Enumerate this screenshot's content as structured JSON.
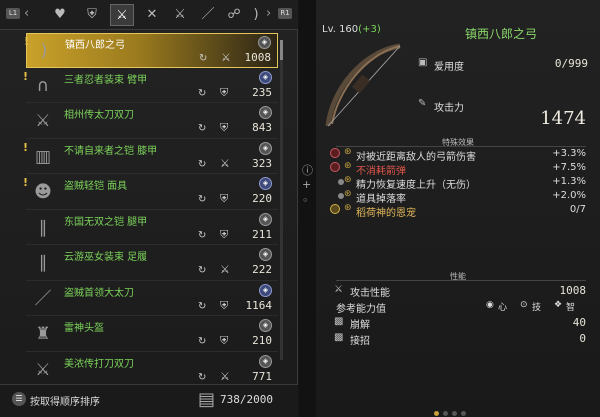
{
  "tabs": {
    "left_badge": "L1",
    "right_badge": "R1",
    "icons": [
      "heart-icon",
      "armor-icon",
      "crossed-swords-icon",
      "crossed-blades-icon",
      "dual-swords-icon",
      "spear-icon",
      "scythe-icon",
      "axe-icon",
      "bow-icon"
    ]
  },
  "inventory": {
    "items": [
      {
        "name": "镇西八郎之弓",
        "value": "1008",
        "new": true,
        "selected": true
      },
      {
        "name": "三者忍者装束 臂甲",
        "value": "235",
        "new": true,
        "selected": false
      },
      {
        "name": "相州传太刀双刀",
        "value": "843",
        "new": false,
        "selected": false
      },
      {
        "name": "不请自来者之铠 膝甲",
        "value": "323",
        "new": true,
        "selected": false
      },
      {
        "name": "盗贼轻铠 面具",
        "value": "220",
        "new": true,
        "selected": false
      },
      {
        "name": "东国无双之铠 腿甲",
        "value": "211",
        "new": false,
        "selected": false
      },
      {
        "name": "云游巫女装束 足履",
        "value": "222",
        "new": false,
        "selected": false
      },
      {
        "name": "盗贼首领大太刀",
        "value": "1164",
        "new": false,
        "selected": false
      },
      {
        "name": "雷神头盔",
        "value": "210",
        "new": false,
        "selected": false
      },
      {
        "name": "美浓传打刀双刀",
        "value": "771",
        "new": false,
        "selected": false
      }
    ],
    "sort_label": "按取得顺序排序",
    "capacity": "738/2000"
  },
  "detail": {
    "level_prefix": "Lv. 160",
    "level_bonus": "(+3)",
    "title": "镇西八郎之弓",
    "familiarity_label": "爱用度",
    "familiarity_value": "0/999",
    "attack_label": "攻击力",
    "attack_value": "1474",
    "special_effects_title": "特殊效果",
    "effects": [
      {
        "label": "对被近距离敌人的弓箭伤害",
        "value": "+3.3%",
        "style": "normal"
      },
      {
        "label": "不消耗箭弹",
        "value": "+7.5%",
        "style": "red"
      },
      {
        "label": "精力恢复速度上升（无伤）",
        "value": "+1.3%",
        "style": "normal"
      },
      {
        "label": "道具掉落率",
        "value": "+2.0%",
        "style": "normal"
      },
      {
        "label": "稻荷神的恩宠",
        "value": "0/7",
        "style": "gold"
      }
    ],
    "performance_title": "性能",
    "attack_perf_label": "攻击性能",
    "attack_perf_value": "1008",
    "ref_label": "参考能力值",
    "attr_heart": "心",
    "attr_skill": "技",
    "attr_wisdom": "智",
    "break_label": "崩解",
    "break_value": "40",
    "parry_label": "接招",
    "parry_value": "0"
  },
  "colors": {
    "selected": "#c9a12a",
    "item_name": "#7cd35a",
    "red_effect": "#e0554a",
    "gold_effect": "#e2b85a"
  }
}
